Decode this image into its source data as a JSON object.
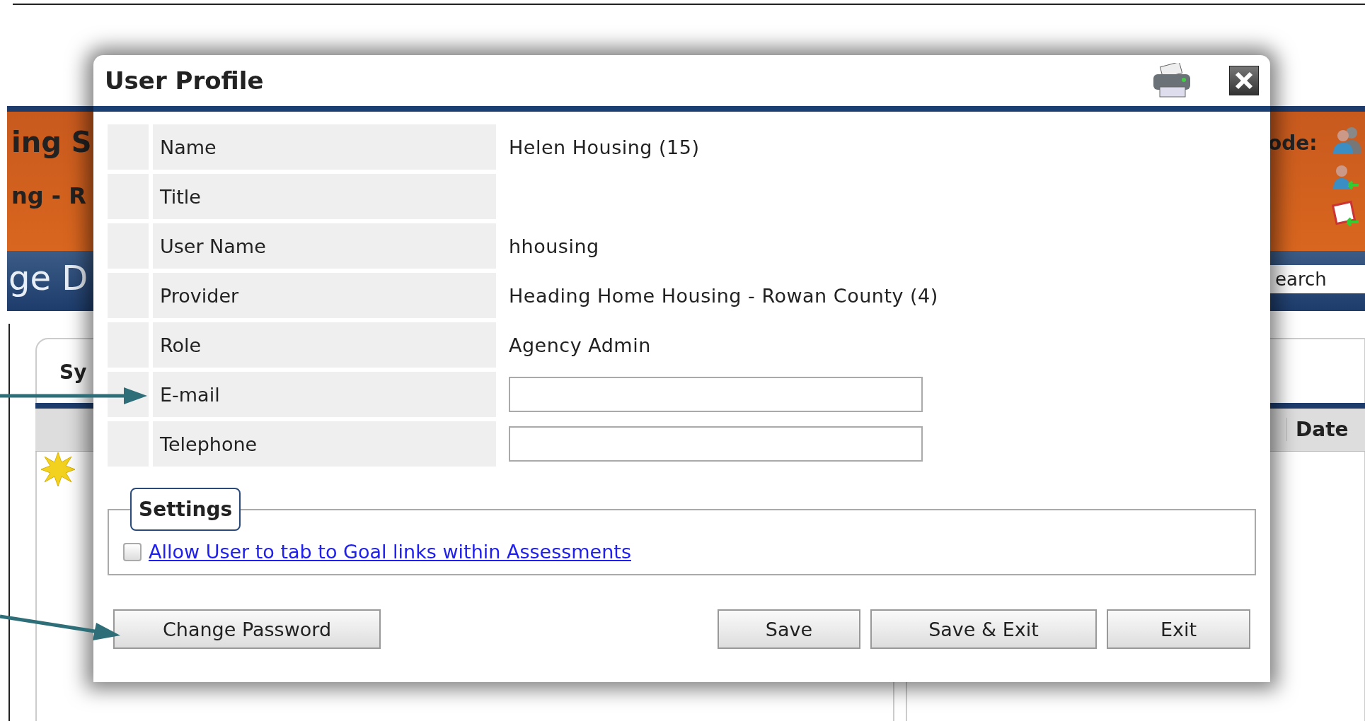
{
  "background": {
    "header_lines": [
      "ing S",
      "ng - R"
    ],
    "mode_label": "ode:",
    "page_title": "ge D",
    "search": {
      "placeholder": "earch"
    },
    "tab": "Sy",
    "column": "Date"
  },
  "dialog": {
    "title": "User Profile",
    "fields": [
      {
        "kind": "text",
        "label": "Name",
        "value": "Helen Housing (15)"
      },
      {
        "kind": "text",
        "label": "Title"
      },
      {
        "kind": "text",
        "label": "User Name",
        "value": "hhousing"
      },
      {
        "kind": "text",
        "label": "Provider",
        "value": "Heading Home Housing - Rowan County (4)"
      },
      {
        "kind": "text",
        "label": "Role",
        "value": "Agency Admin"
      },
      {
        "kind": "input",
        "label": "E-mail"
      },
      {
        "kind": "input",
        "label": "Telephone"
      }
    ],
    "settings": {
      "legend": "Settings",
      "options": [
        {
          "label": "Allow User to tab to Goal links within Assessments",
          "checked": false
        }
      ]
    },
    "left_buttons": [
      "Change Password"
    ],
    "right_buttons": [
      "Save",
      "Save & Exit",
      "Exit"
    ]
  }
}
